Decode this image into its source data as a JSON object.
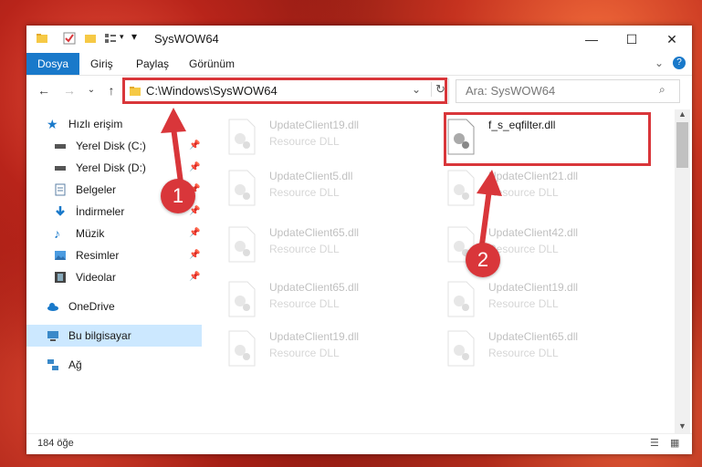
{
  "window": {
    "title": "SysWOW64"
  },
  "ribbon": {
    "tabs": [
      "Dosya",
      "Giriş",
      "Paylaş",
      "Görünüm"
    ]
  },
  "address": {
    "path": "C:\\Windows\\SysWOW64",
    "search_placeholder": "Ara: SysWOW64"
  },
  "nav": {
    "quick_access": "Hızlı erişim",
    "items": [
      "Yerel Disk (C:)",
      "Yerel Disk (D:)",
      "Belgeler",
      "İndirmeler",
      "Müzik",
      "Resimler",
      "Videolar"
    ],
    "onedrive": "OneDrive",
    "this_pc": "Bu bilgisayar",
    "network": "Ağ"
  },
  "files": [
    {
      "name": "UpdateClient19.dll",
      "type": "Resource DLL"
    },
    {
      "name": "f_s_eqfilter.dll",
      "type": ""
    },
    {
      "name": "UpdateClient5.dll",
      "type": "Resource DLL"
    },
    {
      "name": "UpdateClient21.dll",
      "type": "Resource DLL"
    },
    {
      "name": "UpdateClient65.dll",
      "type": "Resource DLL"
    },
    {
      "name": "UpdateClient42.dll",
      "type": "Resource DLL"
    },
    {
      "name": "UpdateClient65.dll",
      "type": "Resource DLL"
    },
    {
      "name": "UpdateClient19.dll",
      "type": "Resource DLL"
    },
    {
      "name": "UpdateClient19.dll",
      "type": "Resource DLL"
    },
    {
      "name": "UpdateClient65.dll",
      "type": "Resource DLL"
    }
  ],
  "status": {
    "count": "184 öğe"
  },
  "annotations": {
    "step1": "1",
    "step2": "2",
    "accent": "#d9363a"
  }
}
